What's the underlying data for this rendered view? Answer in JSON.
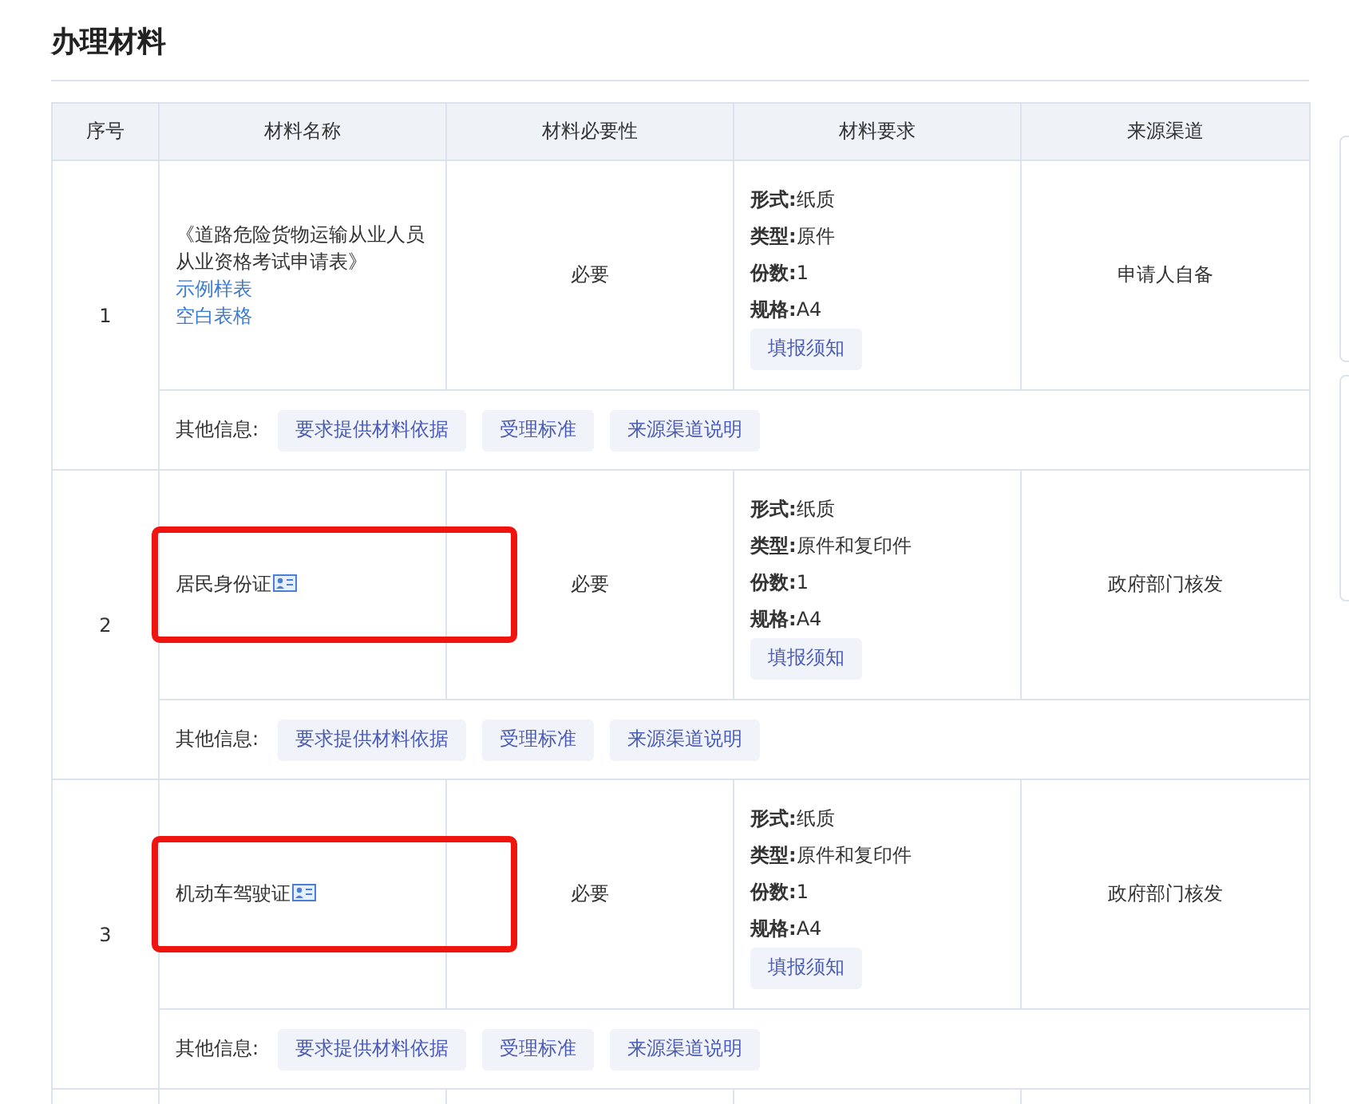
{
  "section_title": "办理材料",
  "table": {
    "columns": [
      "序号",
      "材料名称",
      "材料必要性",
      "材料要求",
      "来源渠道"
    ],
    "rows": [
      {
        "index": "1",
        "name": "《道路危险货物运输从业人员从业资格考试申请表》",
        "has_card_icon": false,
        "highlighted": false,
        "links": [
          "示例样表",
          "空白表格"
        ],
        "necessity": "必要",
        "requirements": [
          {
            "label": "形式:",
            "value": "纸质"
          },
          {
            "label": "类型:",
            "value": "原件"
          },
          {
            "label": "份数:",
            "value": "1"
          },
          {
            "label": "规格:",
            "value": "A4"
          }
        ],
        "notice_button": "填报须知",
        "source": "申请人自备",
        "other_label": "其他信息:",
        "other_buttons": [
          "要求提供材料依据",
          "受理标准",
          "来源渠道说明"
        ]
      },
      {
        "index": "2",
        "name": "居民身份证",
        "has_card_icon": true,
        "highlighted": true,
        "links": [],
        "necessity": "必要",
        "requirements": [
          {
            "label": "形式:",
            "value": "纸质"
          },
          {
            "label": "类型:",
            "value": "原件和复印件"
          },
          {
            "label": "份数:",
            "value": "1"
          },
          {
            "label": "规格:",
            "value": "A4"
          }
        ],
        "notice_button": "填报须知",
        "source": "政府部门核发",
        "other_label": "其他信息:",
        "other_buttons": [
          "要求提供材料依据",
          "受理标准",
          "来源渠道说明"
        ]
      },
      {
        "index": "3",
        "name": "机动车驾驶证",
        "has_card_icon": true,
        "highlighted": true,
        "links": [],
        "necessity": "必要",
        "requirements": [
          {
            "label": "形式:",
            "value": "纸质"
          },
          {
            "label": "类型:",
            "value": "原件和复印件"
          },
          {
            "label": "份数:",
            "value": "1"
          },
          {
            "label": "规格:",
            "value": "A4"
          }
        ],
        "notice_button": "填报须知",
        "source": "政府部门核发",
        "other_label": "其他信息:",
        "other_buttons": [
          "要求提供材料依据",
          "受理标准",
          "来源渠道说明"
        ]
      }
    ]
  }
}
